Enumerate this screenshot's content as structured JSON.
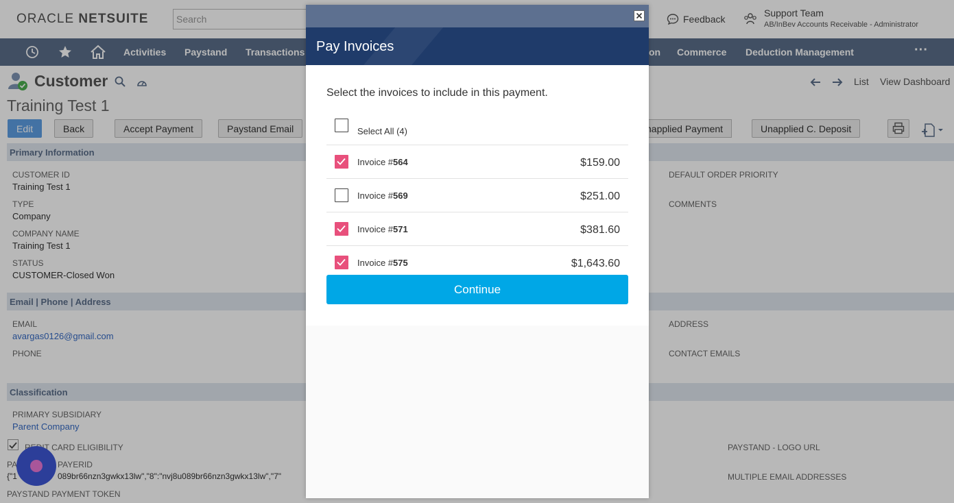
{
  "header": {
    "logo_oracle": "ORACLE",
    "logo_netsuite": "NETSUITE",
    "search_placeholder": "Search",
    "feedback": "Feedback",
    "user_name": "Support Team",
    "user_role": "AB/InBev Accounts Receivable - Administrator"
  },
  "nav": {
    "items": [
      "Activities",
      "Paystand",
      "Transactions",
      "on",
      "Commerce",
      "Deduction Management"
    ]
  },
  "record": {
    "type": "Customer",
    "name": "Training Test 1",
    "links": {
      "list": "List",
      "dashboard": "View Dashboard"
    }
  },
  "buttons": {
    "edit": "Edit",
    "back": "Back",
    "accept_payment": "Accept Payment",
    "paystand_email": "Paystand Email",
    "unapplied_payment": "napplied Payment",
    "unapplied_deposit": "Unapplied C. Deposit"
  },
  "sections": {
    "primary": "Primary Information",
    "contact": "Email | Phone | Address",
    "classification": "Classification"
  },
  "fields": {
    "customer_id_label": "CUSTOMER ID",
    "customer_id": "Training Test 1",
    "type_label": "TYPE",
    "type": "Company",
    "company_label": "COMPANY NAME",
    "company": "Training Test 1",
    "status_label": "STATUS",
    "status": "CUSTOMER-Closed Won",
    "default_priority_label": "DEFAULT ORDER PRIORITY",
    "comments_label": "COMMENTS",
    "email_label": "EMAIL",
    "email": "avargas0126@gmail.com",
    "phone_label": "PHONE",
    "address_label": "ADDRESS",
    "contact_emails_label": "CONTACT EMAILS",
    "subsidiary_label": "PRIMARY SUBSIDIARY",
    "subsidiary": "Parent Company",
    "credit_label": "REDIT CARD ELIGIBILITY",
    "payerid_label": "PAYERID",
    "payerid_prefix": "PA",
    "payerid_value_a": "{\"1",
    "payerid_value_b": "089br66nzn3gwkx13lw\",\"8\":\"nvj8u089br66nzn3gwkx13lw\",\"7\"",
    "token_label": "PAYSTAND PAYMENT TOKEN",
    "logo_url_label": "PAYSTAND - LOGO URL",
    "multi_email_label": "MULTIPLE EMAIL ADDRESSES"
  },
  "modal": {
    "title": "Pay Invoices",
    "instruction": "Select the invoices to include in this payment.",
    "select_all": "Select All (4)",
    "invoice_prefix": "Invoice #",
    "invoices": [
      {
        "number": "564",
        "amount": "$159.00",
        "checked": true
      },
      {
        "number": "569",
        "amount": "$251.00",
        "checked": false
      },
      {
        "number": "571",
        "amount": "$381.60",
        "checked": true
      },
      {
        "number": "575",
        "amount": "$1,643.60",
        "checked": true
      }
    ],
    "continue": "Continue"
  },
  "colors": {
    "nav": "#5a6e89",
    "modal_header": "#1f3b6a",
    "checkbox_checked": "#e8507c",
    "continue": "#00a7e6"
  }
}
